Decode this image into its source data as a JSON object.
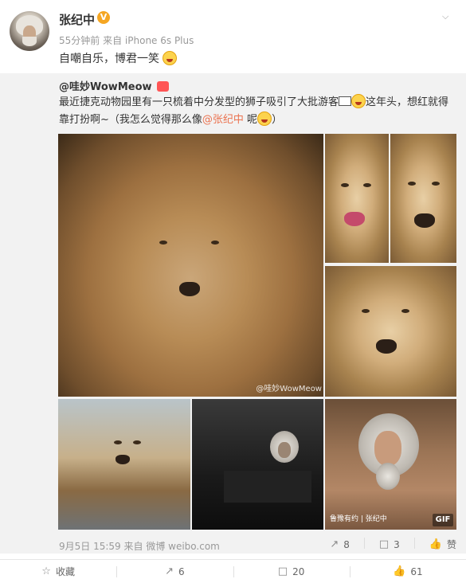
{
  "post": {
    "username": "张纪中",
    "verified_badge": "V",
    "time": "55分钟前",
    "source": "来自 iPhone 6s Plus",
    "text": "自嘲自乐，博君一笑"
  },
  "repost": {
    "user": "@哇妙WowMeow",
    "text_part1": "最近捷克动物园里有一只梳着中分发型的狮子吸引了大批游客",
    "text_part2": "这年头，想红就得靠打扮啊~（我怎么觉得那么像",
    "mention": "@张纪中",
    "text_part3": " 呢",
    "text_part4": "）",
    "watermark": "@哇妙WowMeow",
    "tv_caption": "鲁豫有约 | 张纪中",
    "gif_label": "GIF",
    "footer_time": "9月5日 15:59",
    "footer_source": "来自 微博 weibo.com",
    "reposts": "8",
    "comments": "3",
    "likes_label": "赞"
  },
  "actions": {
    "favorite": "收藏",
    "repost": "6",
    "comment": "20",
    "like": "61"
  },
  "icons": {
    "dropdown": "chevron-down-icon",
    "repost": "repost-icon",
    "comment": "comment-icon",
    "like": "thumbs-up-icon",
    "favorite": "star-icon"
  },
  "colors": {
    "mention": "#eb7350",
    "verified": "#f5a623",
    "repost_bg": "#f2f2f2"
  }
}
